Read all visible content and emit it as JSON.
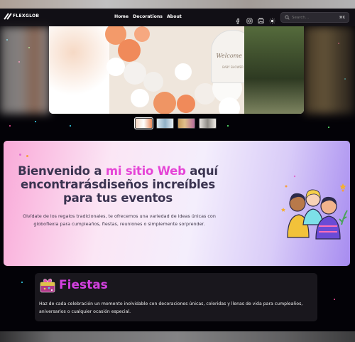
{
  "brand": {
    "name": "FLEXGLOB"
  },
  "nav": {
    "links": [
      "Home",
      "Decorations",
      "About"
    ]
  },
  "social": {
    "icons": [
      "facebook-icon",
      "instagram-icon",
      "gallery-icon",
      "theme-toggle-icon"
    ]
  },
  "search": {
    "placeholder": "Search...",
    "shortcut": "⌘K"
  },
  "hero": {
    "sign_line1": "Welcome to",
    "sign_line2": "BABY SHOWER"
  },
  "welcome": {
    "title_part1": "Bienvenido a ",
    "title_highlight": "mi sitio Web",
    "title_part2": " aquí encontrarásdiseños increíbles para tus eventos",
    "description": "Olvídate de los regalos tradicionales, te ofrecemos una variedad de ideas únicas con globoflexia para cumpleaños, fiestas, reuniones o simplemente sorprender."
  },
  "fiestas": {
    "title": "Fiestas",
    "text": "Haz de cada celebración un momento inolvidable con decoraciones únicas, coloridas y llenas de vida para cumpleaños, aniversarios o cualquier ocasión especial."
  },
  "colors": {
    "accent": "#e544d6",
    "title": "#3a3350"
  }
}
